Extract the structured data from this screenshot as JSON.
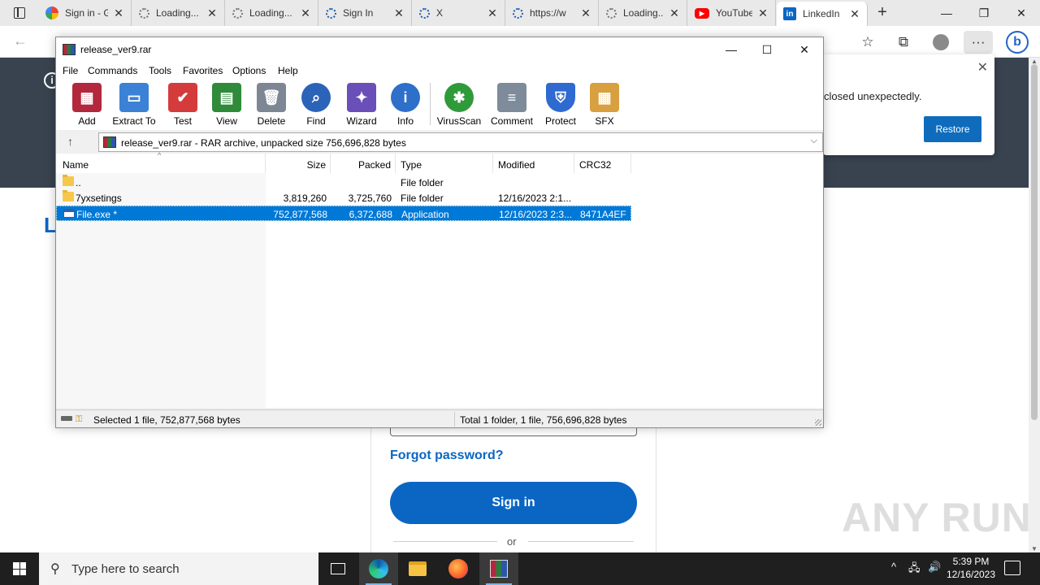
{
  "browser": {
    "tabs": [
      {
        "title": "Sign in - G",
        "icon": "google-icon"
      },
      {
        "title": "Loading...",
        "icon": "loading-icon"
      },
      {
        "title": "Loading...",
        "icon": "loading-icon"
      },
      {
        "title": "Sign In",
        "icon": "loading-icon"
      },
      {
        "title": "X",
        "icon": "loading-icon"
      },
      {
        "title": "https://w",
        "icon": "loading-icon"
      },
      {
        "title": "Loading...",
        "icon": "loading-icon"
      },
      {
        "title": "YouTube",
        "icon": "youtube-icon"
      },
      {
        "title": "LinkedIn",
        "icon": "linkedin-icon"
      }
    ],
    "restore_popup": {
      "message": "closed unexpectedly.",
      "button": "Restore"
    }
  },
  "page": {
    "forgot": "Forgot password?",
    "signin": "Sign in",
    "or": "or",
    "logo_letter": "L",
    "info_glyph": "i",
    "watermark": "ANY RUN"
  },
  "winrar": {
    "title": "release_ver9.rar",
    "menu": [
      "File",
      "Commands",
      "Tools",
      "Favorites",
      "Options",
      "Help"
    ],
    "toolbar": [
      {
        "label": "Add",
        "icon": "add-icon",
        "color": "#b3283c"
      },
      {
        "label": "Extract To",
        "icon": "extract-icon",
        "color": "#3b82d6"
      },
      {
        "label": "Test",
        "icon": "test-icon",
        "color": "#d43c3c"
      },
      {
        "label": "View",
        "icon": "view-icon",
        "color": "#2f8a3a"
      },
      {
        "label": "Delete",
        "icon": "delete-icon",
        "color": "#7d8794"
      },
      {
        "label": "Find",
        "icon": "find-icon",
        "color": "#2a63b8"
      },
      {
        "label": "Wizard",
        "icon": "wizard-icon",
        "color": "#6a4fb8"
      },
      {
        "label": "Info",
        "icon": "info-icon",
        "color": "#2d6fc9"
      },
      {
        "label": "VirusScan",
        "icon": "virusscan-icon",
        "color": "#2f9a3a"
      },
      {
        "label": "Comment",
        "icon": "comment-icon",
        "color": "#7d8b9a"
      },
      {
        "label": "Protect",
        "icon": "protect-icon",
        "color": "#2f6ad0"
      },
      {
        "label": "SFX",
        "icon": "sfx-icon",
        "color": "#d9a040"
      }
    ],
    "path": "release_ver9.rar - RAR archive, unpacked size 756,696,828 bytes",
    "columns": [
      "Name",
      "Size",
      "Packed",
      "Type",
      "Modified",
      "CRC32"
    ],
    "rows": [
      {
        "name": "..",
        "size": "",
        "packed": "",
        "type": "File folder",
        "modified": "",
        "crc": "",
        "kind": "folder"
      },
      {
        "name": "7yxsetings",
        "size": "3,819,260",
        "packed": "3,725,760",
        "type": "File folder",
        "modified": "12/16/2023 2:1...",
        "crc": "",
        "kind": "folder"
      },
      {
        "name": "File.exe *",
        "size": "752,877,568",
        "packed": "6,372,688",
        "type": "Application",
        "modified": "12/16/2023 2:3...",
        "crc": "8471A4EF",
        "kind": "exe"
      }
    ],
    "status_left": "Selected 1 file, 752,877,568 bytes",
    "status_right": "Total 1 folder, 1 file, 756,696,828 bytes"
  },
  "taskbar": {
    "search_placeholder": "Type here to search",
    "time": "5:39 PM",
    "date": "12/16/2023"
  }
}
